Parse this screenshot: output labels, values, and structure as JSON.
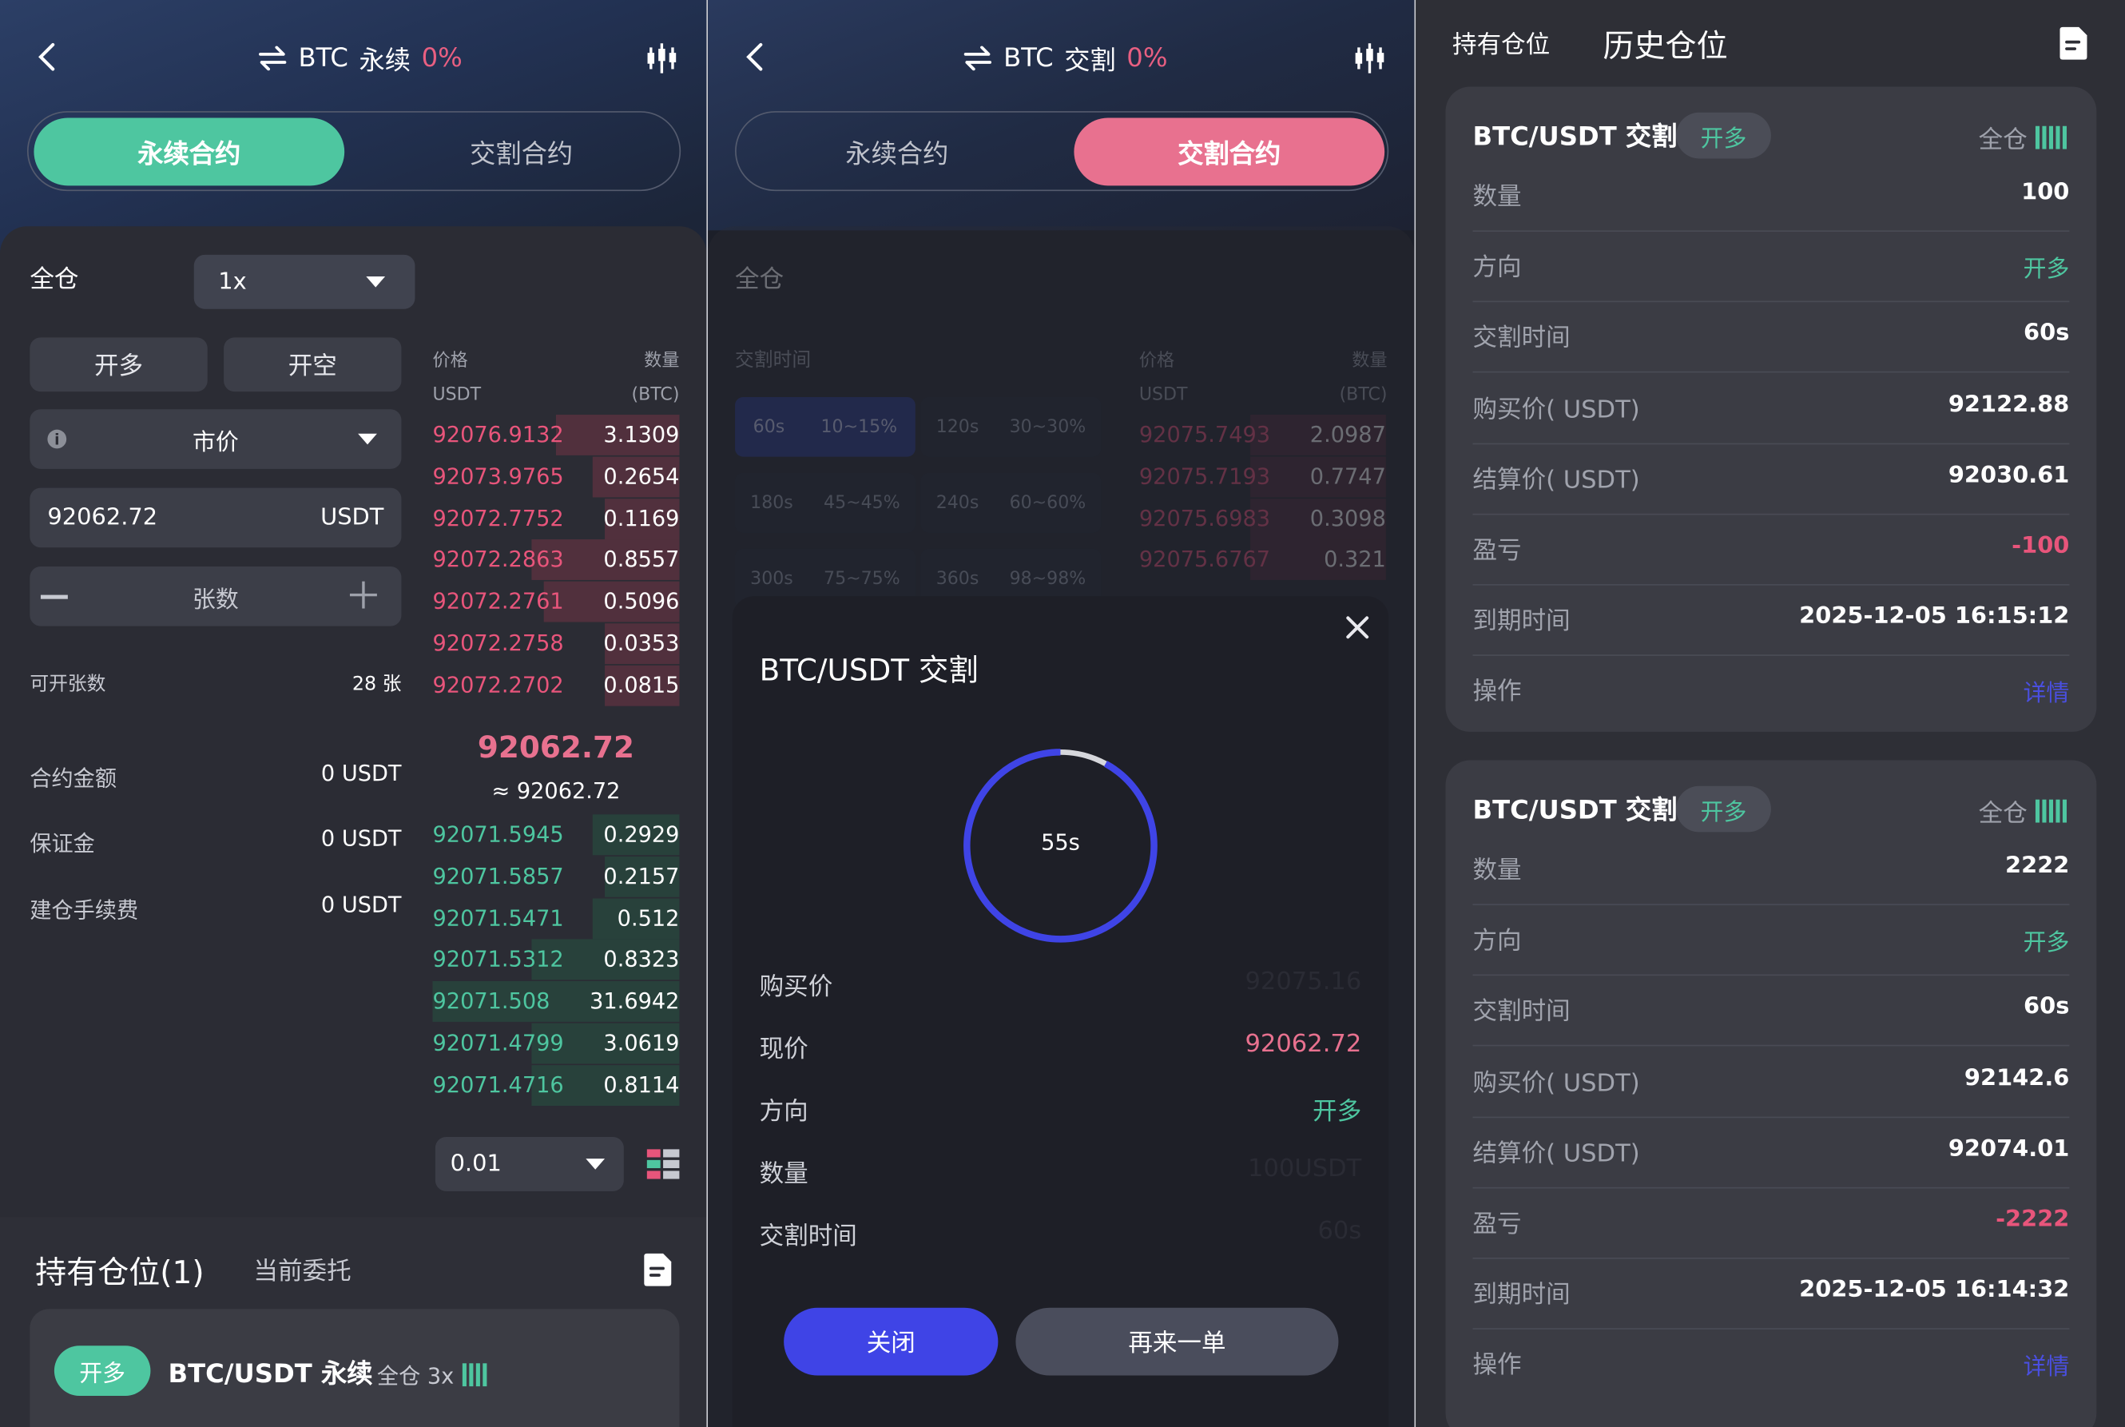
{
  "left": {
    "title": {
      "symbol": "BTC",
      "mode": "永续",
      "pct": "0%"
    },
    "tabs": {
      "perpetual": "永续合约",
      "delivery": "交割合约"
    },
    "margin_mode": "全仓",
    "leverage": "1x",
    "open_long": "开多",
    "open_short": "开空",
    "order_type": "市价",
    "price_value": "92062.72",
    "price_unit": "USDT",
    "qty_placeholder": "张数",
    "available_label": "可开张数",
    "available_value": "28 张",
    "contract_amount_label": "合约金额",
    "contract_amount_value": "0 USDT",
    "margin_label": "保证金",
    "margin_value": "0 USDT",
    "fee_label": "建仓手续费",
    "fee_value": "0 USDT",
    "orderbook": {
      "price_header": "价格",
      "qty_header": "数量",
      "price_unit": "USDT",
      "qty_unit": "(BTC)",
      "asks": [
        {
          "price": "92076.9132",
          "qty": "3.1309",
          "depth": 0.5
        },
        {
          "price": "92073.9765",
          "qty": "0.2654",
          "depth": 0.35
        },
        {
          "price": "92072.7752",
          "qty": "0.1169",
          "depth": 0.3
        },
        {
          "price": "92072.2863",
          "qty": "0.8557",
          "depth": 0.6
        },
        {
          "price": "92072.2761",
          "qty": "0.5096",
          "depth": 0.55
        },
        {
          "price": "92072.2758",
          "qty": "0.0353",
          "depth": 0.3
        },
        {
          "price": "92072.2702",
          "qty": "0.0815",
          "depth": 0.3
        }
      ],
      "last_price": "92062.72",
      "last_price_approx": "≈ 92062.72",
      "bids": [
        {
          "price": "92071.5945",
          "qty": "0.2929",
          "depth": 0.35
        },
        {
          "price": "92071.5857",
          "qty": "0.2157",
          "depth": 0.3
        },
        {
          "price": "92071.5471",
          "qty": "0.512",
          "depth": 0.35
        },
        {
          "price": "92071.5312",
          "qty": "0.8323",
          "depth": 0.6
        },
        {
          "price": "92071.508",
          "qty": "31.6942",
          "depth": 1.0
        },
        {
          "price": "92071.4799",
          "qty": "3.0619",
          "depth": 0.6
        },
        {
          "price": "92071.4716",
          "qty": "0.8114",
          "depth": 0.6
        }
      ],
      "precision": "0.01"
    },
    "positions_tab": "持有仓位(1)",
    "orders_tab": "当前委托",
    "position_card": {
      "side": "开多",
      "name": "BTC/USDT 永续",
      "mode": "全仓 3x"
    }
  },
  "middle": {
    "title": {
      "symbol": "BTC",
      "mode": "交割",
      "pct": "0%"
    },
    "tabs": {
      "perpetual": "永续合约",
      "delivery": "交割合约"
    },
    "margin_mode": "全仓",
    "delivery_time_label": "交割时间",
    "tiles": [
      {
        "time": "60s",
        "range": "10~15%"
      },
      {
        "time": "120s",
        "range": "30~30%"
      },
      {
        "time": "180s",
        "range": "45~45%"
      },
      {
        "time": "240s",
        "range": "60~60%"
      },
      {
        "time": "300s",
        "range": "75~75%"
      },
      {
        "time": "360s",
        "range": "98~98%"
      }
    ],
    "orderbook": {
      "price_header": "价格",
      "qty_header": "数量",
      "price_unit": "USDT",
      "qty_unit": "(BTC)",
      "asks": [
        {
          "price": "92075.7493",
          "qty": "2.0987"
        },
        {
          "price": "92075.7193",
          "qty": "0.7747"
        },
        {
          "price": "92075.6983",
          "qty": "0.3098"
        },
        {
          "price": "92075.6767",
          "qty": "0.321"
        }
      ]
    },
    "modal": {
      "title": "BTC/USDT 交割",
      "countdown": "55s",
      "countdown_progress": 0.92,
      "buy_price_label": "购买价",
      "buy_price": "92075.16",
      "current_price_label": "现价",
      "current_price": "92062.72",
      "direction_label": "方向",
      "direction": "开多",
      "qty_label": "数量",
      "qty": "100USDT",
      "delivery_time_label": "交割时间",
      "delivery_time": "60s",
      "close_btn": "关闭",
      "again_btn": "再来一单"
    }
  },
  "right": {
    "tabs": {
      "holding": "持有仓位",
      "history": "历史仓位"
    },
    "positions": [
      {
        "name": "BTC/USDT 交割",
        "side": "开多",
        "mode": "全仓",
        "rows": [
          {
            "label": "数量",
            "value": "100"
          },
          {
            "label": "方向",
            "value": "开多"
          },
          {
            "label": "交割时间",
            "value": "60s"
          },
          {
            "label": "购买价( USDT)",
            "value": "92122.88"
          },
          {
            "label": "结算价( USDT)",
            "value": "92030.61"
          },
          {
            "label": "盈亏",
            "value": "-100"
          },
          {
            "label": "到期时间",
            "value": "2025-12-05 16:15:12"
          },
          {
            "label": "操作",
            "value": "详情"
          }
        ]
      },
      {
        "name": "BTC/USDT 交割",
        "side": "开多",
        "mode": "全仓",
        "rows": [
          {
            "label": "数量",
            "value": "2222"
          },
          {
            "label": "方向",
            "value": "开多"
          },
          {
            "label": "交割时间",
            "value": "60s"
          },
          {
            "label": "购买价( USDT)",
            "value": "92142.6"
          },
          {
            "label": "结算价( USDT)",
            "value": "92074.01"
          },
          {
            "label": "盈亏",
            "value": "-2222"
          },
          {
            "label": "到期时间",
            "value": "2025-12-05 16:14:32"
          },
          {
            "label": "操作",
            "value": "详情"
          }
        ]
      }
    ]
  },
  "colors": {
    "green": "#4ec6a0",
    "red": "#e8557b",
    "pink": "#e8718f",
    "blue": "#3f44e6",
    "accent_link": "#4a4fe0"
  }
}
